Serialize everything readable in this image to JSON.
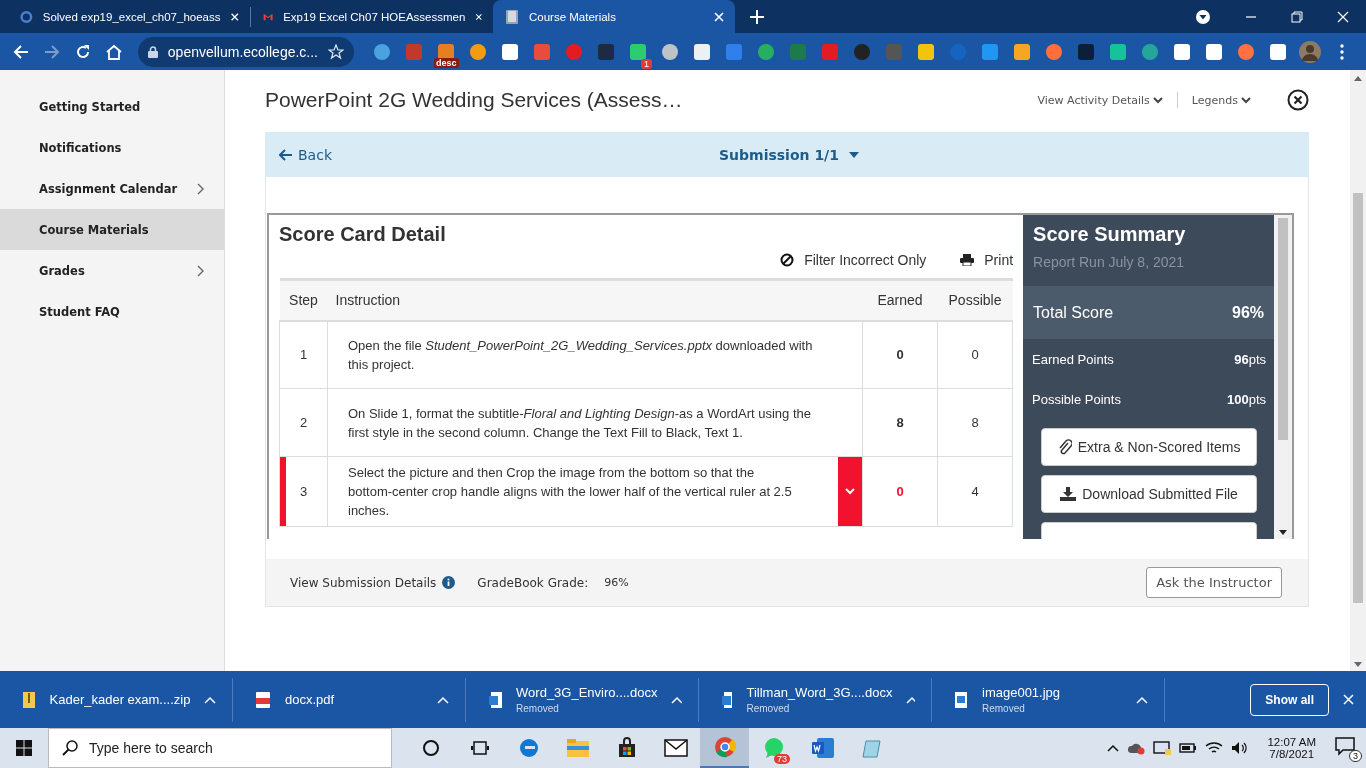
{
  "browser": {
    "tabs": [
      {
        "title": "Solved exp19_excel_ch07_hoeass",
        "kind": "ring",
        "selected": false
      },
      {
        "title": "Exp19 Excel Ch07 HOEAssessmen",
        "kind": "mail",
        "selected": false
      },
      {
        "title": "Course Materials",
        "kind": "book",
        "selected": true
      }
    ],
    "address": "openvellum.ecollege.c...",
    "forward_disabled": true,
    "extension_label": "desc",
    "extension_badge": "1"
  },
  "sidebar": {
    "items": [
      {
        "label": "Getting Started",
        "selected": false,
        "has_children": false
      },
      {
        "label": "Notifications",
        "selected": false,
        "has_children": false
      },
      {
        "label": "Assignment Calendar",
        "selected": false,
        "has_children": true
      },
      {
        "label": "Course Materials",
        "selected": true,
        "has_children": false
      },
      {
        "label": "Grades",
        "selected": false,
        "has_children": true
      },
      {
        "label": "Student FAQ",
        "selected": false,
        "has_children": false
      }
    ]
  },
  "header": {
    "title": "PowerPoint 2G Wedding Services (Assess…",
    "links": [
      "View Activity Details",
      "Legends"
    ]
  },
  "submission_bar": {
    "back": "Back",
    "submission": "Submission 1/1"
  },
  "score_card": {
    "title": "Score Card Detail",
    "filter": "Filter Incorrect Only",
    "print": "Print",
    "columns": [
      "Step",
      "Instruction",
      "Earned",
      "Possible"
    ],
    "rows": [
      {
        "step": "1",
        "instruction": "Open the file *Student_PowerPoint_2G_Wedding_Services.pptx* downloaded with this project.",
        "earned": "0",
        "possible": "0",
        "incorrect": false
      },
      {
        "step": "2",
        "instruction": "On Slide 1, format the subtitle-*Floral and Lighting Design*-as a WordArt using the first style in the second column. Change the Text Fill to Black, Text 1.",
        "earned": "8",
        "possible": "8",
        "incorrect": false
      },
      {
        "step": "3",
        "instruction": "Select the picture and then Crop the image from the bottom so that the bottom-center crop handle aligns with the lower half of the vertical ruler at 2.5 inches.",
        "earned": "0",
        "possible": "4",
        "incorrect": true
      }
    ]
  },
  "score_summary": {
    "title": "Score Summary",
    "report_run": "Report Run July 8, 2021",
    "total_label": "Total Score",
    "total": "96%",
    "points": [
      {
        "label": "Earned Points",
        "value": "**96**pts"
      },
      {
        "label": "Possible Points",
        "value": "**100**pts"
      }
    ],
    "buttons": [
      {
        "label": "Extra & Non-Scored Items",
        "kind": "clip"
      },
      {
        "label": "Download Submitted File",
        "kind": "download"
      }
    ]
  },
  "footer": {
    "details": "View Submission Details",
    "grade_label": "GradeBook Grade:",
    "grade": "96%",
    "ask": "Ask the Instructor"
  },
  "downloads": {
    "items": [
      {
        "name": "Kader_kader exam....zip",
        "kind": "zip"
      },
      {
        "name": "docx.pdf",
        "kind": "pdf"
      },
      {
        "name": "Word_3G_Enviro....docx",
        "kind": "word",
        "status": "Removed"
      },
      {
        "name": "Tillman_Word_3G....docx",
        "kind": "word",
        "status": "Removed"
      },
      {
        "name": "image001.jpg",
        "kind": "image",
        "status": "Removed"
      }
    ],
    "show_all": "Show all"
  },
  "taskbar": {
    "search_placeholder": "Type here to search",
    "apps": [
      {
        "kind": "cortana",
        "active": false
      },
      {
        "kind": "taskview",
        "active": false
      },
      {
        "kind": "edge",
        "active": false
      },
      {
        "kind": "explorer",
        "active": false
      },
      {
        "kind": "store",
        "active": false
      },
      {
        "kind": "mail",
        "active": false
      },
      {
        "kind": "chrome",
        "active": true
      },
      {
        "kind": "whatsapp",
        "active": false,
        "badge": "73"
      },
      {
        "kind": "word",
        "active": false
      },
      {
        "kind": "app",
        "active": false
      }
    ],
    "time": "12:07 AM",
    "date": "7/8/2021",
    "notifications": "3"
  }
}
